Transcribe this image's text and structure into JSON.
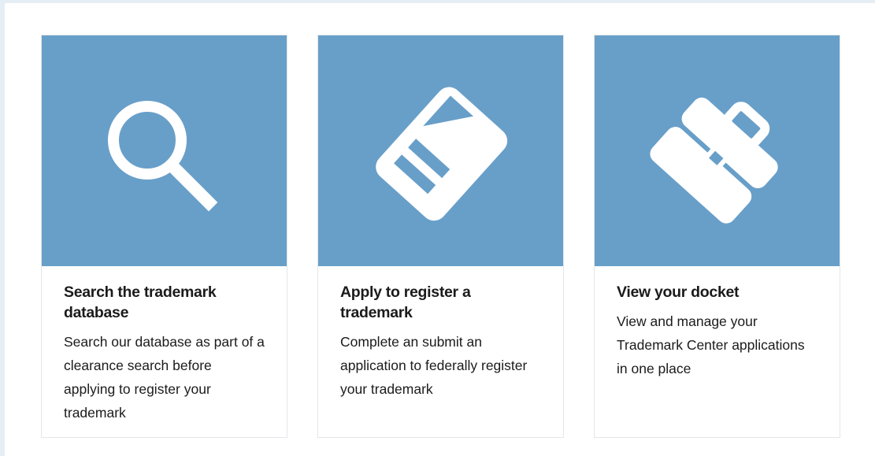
{
  "colors": {
    "hero_background": "#689fc9",
    "icon_fill": "#ffffff",
    "title_text": "#1b1b1b",
    "body_text": "#1b1b1b"
  },
  "cards": [
    {
      "icon": "magnifying-glass-icon",
      "title": "Search the trademark database",
      "description": "Search our database as part of a clearance search before applying to register your trademark"
    },
    {
      "icon": "document-icon",
      "title": "Apply to register a trademark",
      "description": "Complete an submit an application to federally register your trademark"
    },
    {
      "icon": "briefcase-icon",
      "title": "View your docket",
      "description": "View and manage your Trademark Center applications in one place"
    }
  ]
}
